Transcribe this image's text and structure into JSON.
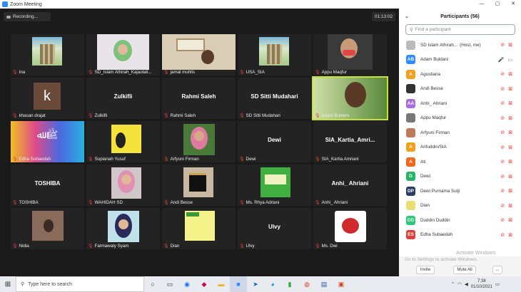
{
  "window": {
    "title": "Zoom Meeting",
    "min": "—",
    "max": "▢",
    "close": "✕"
  },
  "meeting": {
    "recording": "Recording...",
    "timer": "01:13:02"
  },
  "tiles": [
    {
      "name": "Ina",
      "kind": "building"
    },
    {
      "name": "SD_Islam Athirah_Kajaolali...",
      "kind": "person-hijab"
    },
    {
      "name": "jamal muhlis",
      "kind": "person-room"
    },
    {
      "name": "USA_SIA",
      "kind": "building"
    },
    {
      "name": "Appu Maqfur",
      "kind": "person-masked"
    },
    {
      "name": "khasan drajat",
      "kind": "initial",
      "initial": "k"
    },
    {
      "name": "Zulkifli",
      "kind": "text"
    },
    {
      "name": "Rahmi Saleh",
      "kind": "text"
    },
    {
      "name": "SD Sitti Mudahari",
      "kind": "text"
    },
    {
      "name": "Adam Buldani",
      "kind": "person-active"
    },
    {
      "name": "Edha Subaedah",
      "kind": "calligraphy"
    },
    {
      "name": "Supianah Yusuf",
      "kind": "poster"
    },
    {
      "name": "Arfyuni Firman",
      "kind": "person-pink"
    },
    {
      "name": "Dewi",
      "kind": "text"
    },
    {
      "name": "SIA_Kartia Amriani",
      "kind": "text",
      "label": "SIA_Kartia_Amri..."
    },
    {
      "name": "TOSHIBA",
      "kind": "text"
    },
    {
      "name": "WAHIDAH SD",
      "kind": "person-pink2"
    },
    {
      "name": "Andi Besse",
      "kind": "kaaba"
    },
    {
      "name": "Ms. Rhya Adriani",
      "kind": "greencard"
    },
    {
      "name": "Anhi_ Ahriani",
      "kind": "text"
    },
    {
      "name": "Nidia",
      "kind": "room"
    },
    {
      "name": "Fatmawaty Syam",
      "kind": "person-hijab2"
    },
    {
      "name": "Dian",
      "kind": "yellowcard"
    },
    {
      "name": "Ulvy",
      "kind": "text"
    },
    {
      "name": "Ms. Dwi",
      "kind": "teaching"
    }
  ],
  "panel": {
    "title": "Participants (56)",
    "search_placeholder": "Find a participant",
    "participants": [
      {
        "initials": "",
        "name": "SD Islam Athirah...",
        "suffix": "(Host, me)",
        "color": "#bbbbbb",
        "mic": "muted",
        "video": "off"
      },
      {
        "initials": "AB",
        "name": "Adam Buldani",
        "color": "#2d8cff",
        "mic": "on",
        "video": "on"
      },
      {
        "initials": "A",
        "name": "Agustiana",
        "color": "#f29f1b",
        "mic": "muted",
        "video": "off"
      },
      {
        "initials": "",
        "name": "Andi Besse",
        "color": "#333333",
        "mic": "muted",
        "video": "off"
      },
      {
        "initials": "AA",
        "name": "Anhi_ Ahriani",
        "color": "#a86de0",
        "mic": "muted",
        "video": "off"
      },
      {
        "initials": "",
        "name": "Appu Maqfur",
        "color": "#777777",
        "mic": "muted",
        "video": "off"
      },
      {
        "initials": "",
        "name": "Arfyuni Firman",
        "color": "#c07a5a",
        "mic": "muted",
        "video": "off"
      },
      {
        "initials": "A",
        "name": "Arifuddin/SIA",
        "color": "#f29f1b",
        "mic": "muted",
        "video": "off"
      },
      {
        "initials": "A",
        "name": "Ati",
        "color": "#f2671b",
        "mic": "muted",
        "video": "off"
      },
      {
        "initials": "D",
        "name": "Dewi",
        "color": "#29b365",
        "mic": "muted",
        "video": "off"
      },
      {
        "initials": "DP",
        "name": "Dewi Purnama Sutji",
        "color": "#2c3e66",
        "mic": "muted",
        "video": "off"
      },
      {
        "initials": "",
        "name": "Dian",
        "color": "#e8e070",
        "mic": "muted",
        "video": "off"
      },
      {
        "initials": "DD",
        "name": "Duddin Duddin",
        "color": "#29c97a",
        "mic": "muted",
        "video": "off"
      },
      {
        "initials": "ES",
        "name": "Edha Subaedah",
        "color": "#e0403a",
        "mic": "muted",
        "video": "off"
      }
    ],
    "invite": "Invite",
    "mute_all": "Mute All",
    "more": "...",
    "watermark1": "Activate Windows",
    "watermark2": "Go to Settings to activate Windows."
  },
  "taskbar": {
    "search": "Type here to search",
    "time": "7:38",
    "date": "01/10/2021"
  }
}
